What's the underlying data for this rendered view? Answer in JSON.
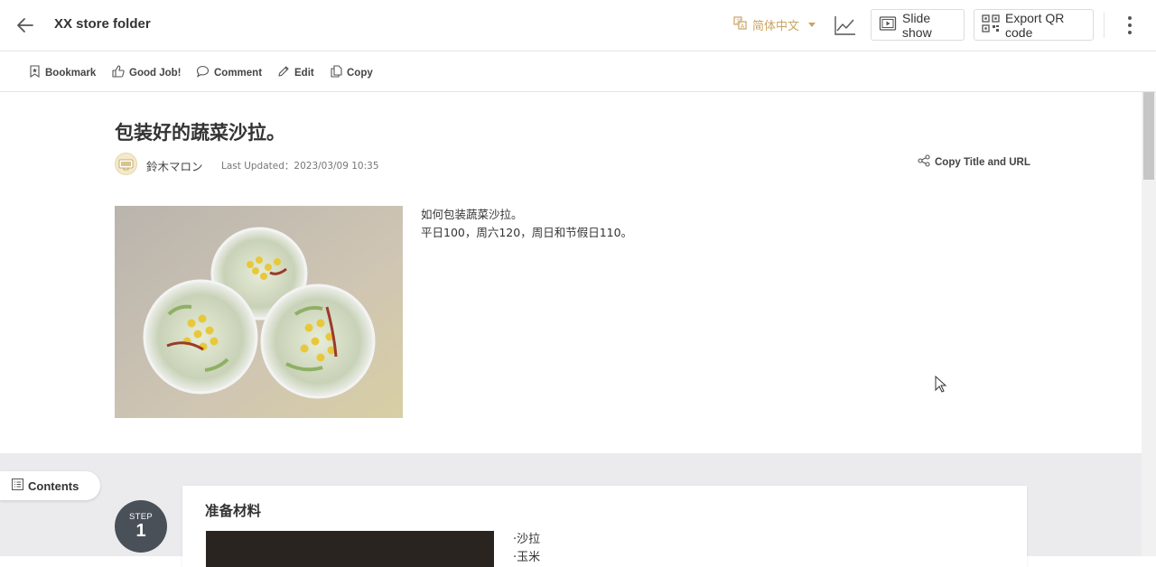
{
  "header": {
    "folder_title": "XX store folder",
    "language": "简体中文",
    "slideshow_label": "Slide show",
    "qr_label": "Export QR code"
  },
  "toolbar": {
    "bookmark": "Bookmark",
    "good_job": "Good Job!",
    "comment": "Comment",
    "edit": "Edit",
    "copy": "Copy"
  },
  "article": {
    "title": "包装好的蔬菜沙拉。",
    "author": "鈴木マロン",
    "last_updated": "Last Updated：2023/03/09 10:35",
    "copy_url_label": "Copy Title and URL",
    "description": [
      "如何包装蔬菜沙拉。",
      "平日100，周六120，周日和节假日110。"
    ]
  },
  "steps_nav": {
    "contents_label": "Contents"
  },
  "steps": [
    {
      "label": "STEP",
      "number": "1",
      "title": "准备材料",
      "items": [
        "·沙拉",
        "·玉米"
      ]
    }
  ],
  "colors": {
    "accent_gold": "#c9a463",
    "step_badge": "#4a5058",
    "steps_bg": "#ebebee"
  }
}
